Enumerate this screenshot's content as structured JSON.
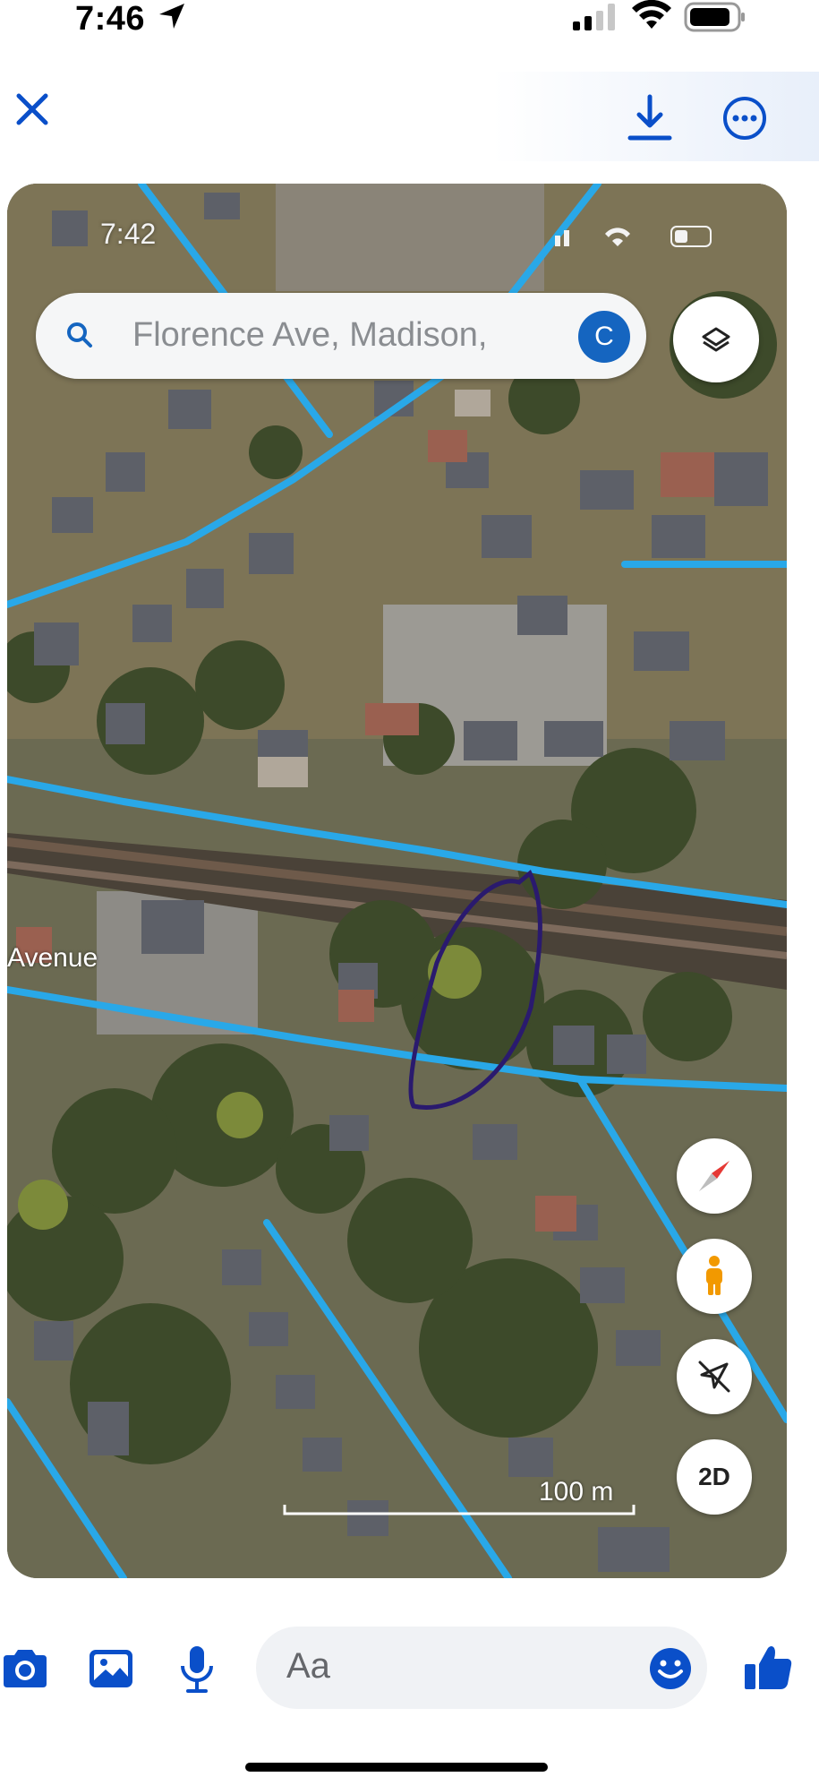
{
  "status_bar": {
    "time": "7:46"
  },
  "top_bar": {
    "close_icon": "close-icon",
    "download_icon": "download-icon",
    "more_icon": "more-icon"
  },
  "map": {
    "inner_time": "7:42",
    "search": {
      "text": "Florence Ave, Madison,",
      "avatar_letter": "C"
    },
    "street_label": "Avenue",
    "scale": "100 m",
    "controls": {
      "two_d_label": "2D"
    }
  },
  "composer": {
    "placeholder": "Aa"
  },
  "colors": {
    "accent": "#0a4fc9",
    "road_highlight": "#29a8e8",
    "annotation_stroke": "#2a1a6e"
  }
}
